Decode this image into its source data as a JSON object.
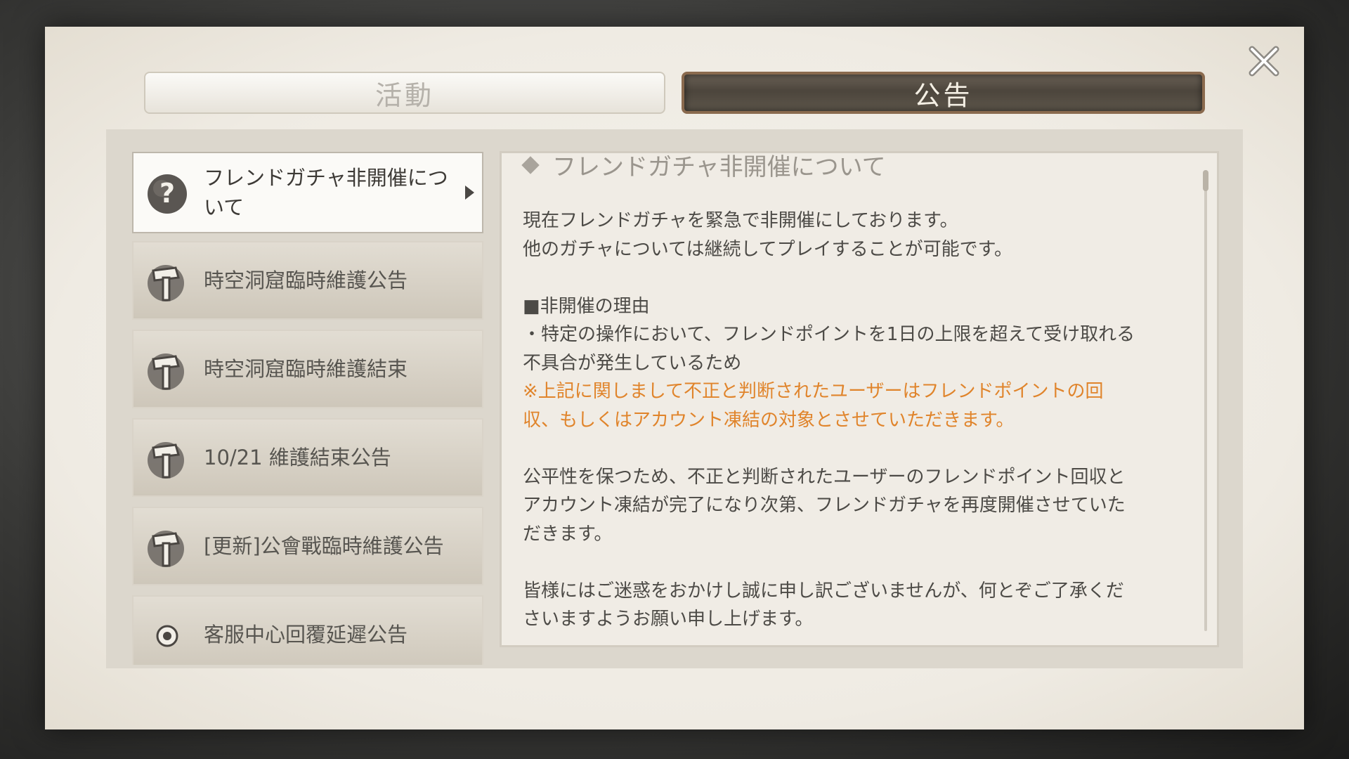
{
  "tabs": {
    "activity_label": "活動",
    "notice_label": "公告"
  },
  "notices": [
    {
      "title": "フレンドガチャ非開催について",
      "icon": "question-mark-icon",
      "selected": true
    },
    {
      "title": "時空洞窟臨時維護公告",
      "icon": "hammer-icon"
    },
    {
      "title": "時空洞窟臨時維護結束",
      "icon": "hammer-icon"
    },
    {
      "title": "10/21 維護結束公告",
      "icon": "hammer-icon"
    },
    {
      "title": "[更新]公會戰臨時維護公告",
      "icon": "hammer-icon"
    },
    {
      "title": "客服中心回覆延遲公告",
      "icon": "gear-icon"
    }
  ],
  "detail": {
    "title": "フレンドガチャ非開催について",
    "p1_line1": "現在フレンドガチャを緊急で非開催にしております。",
    "p1_line2": "他のガチャについては継続してプレイすることが可能です。",
    "reason_heading": "■非開催の理由",
    "reason_line1": "・特定の操作において、フレンドポイントを1日の上限を超えて受け取れる",
    "reason_line2": "不具合が発生しているため",
    "warning_line1": "※上記に関しまして不正と判断されたユーザーはフレンドポイントの回",
    "warning_line2": "収、もしくはアカウント凍結の対象とさせていただきます。",
    "p3_line1": "公平性を保つため、不正と判断されたユーザーのフレンドポイント回収と",
    "p3_line2": "アカウント凍結が完了になり次第、フレンドガチャを再度開催させていた",
    "p3_line3": "だきます。",
    "p4_line1": "皆様にはご迷惑をおかけし誠に申し訳ございませんが、何とぞご了承くだ",
    "p4_line2": "さいますようお願い申し上げます。"
  },
  "colors": {
    "warning_text": "#e0842b",
    "body_text": "#4c4a46",
    "tab_active_border": "#8a6a4e"
  }
}
